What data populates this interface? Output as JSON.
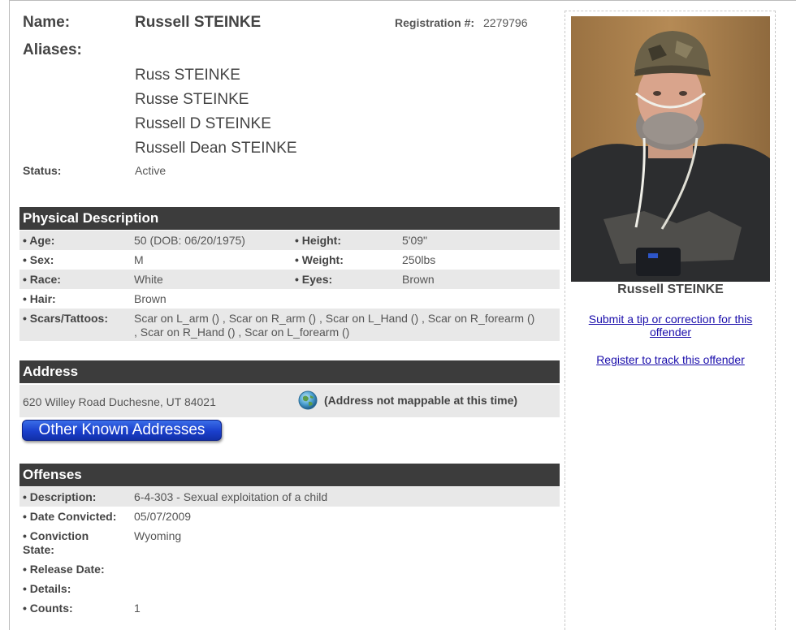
{
  "header": {
    "name_label": "Name:",
    "name_value": "Russell STEINKE",
    "registration_label": "Registration #:",
    "registration_value": "2279796",
    "aliases_label": "Aliases:",
    "aliases": [
      "Russ STEINKE",
      "Russe STEINKE",
      "Russell D STEINKE",
      "Russell Dean STEINKE"
    ],
    "status_label": "Status:",
    "status_value": "Active"
  },
  "physical": {
    "title": "Physical Description",
    "age_label": "• Age:",
    "age_value": "50  (DOB: 06/20/1975)",
    "height_label": "• Height:",
    "height_value": "5'09\"",
    "sex_label": "• Sex:",
    "sex_value": "M",
    "weight_label": "• Weight:",
    "weight_value": "250lbs",
    "race_label": "• Race:",
    "race_value": "White",
    "eyes_label": "• Eyes:",
    "eyes_value": "Brown",
    "hair_label": "• Hair:",
    "hair_value": "Brown",
    "scars_label": "• Scars/Tattoos:",
    "scars_line1": "Scar on L_arm () , Scar on R_arm () , Scar on L_Hand () , Scar on R_forearm ()",
    "scars_line2": ", Scar on R_Hand () , Scar on L_forearm ()"
  },
  "address": {
    "title": "Address",
    "value": "620 Willey Road Duchesne, UT 84021",
    "map_note": "(Address not mappable at this time)",
    "other_button": "Other Known Addresses"
  },
  "offenses": {
    "title": "Offenses",
    "description_label": "• Description:",
    "description_value": "6-4-303 - Sexual exploitation of a child",
    "date_label": "• Date Convicted:",
    "date_value": "05/07/2009",
    "state_label_1": "• Conviction",
    "state_label_2": "State:",
    "state_value": "Wyoming",
    "release_label": "• Release Date:",
    "details_label": "• Details:",
    "counts_label": "• Counts:",
    "counts_value": "1"
  },
  "sidebar": {
    "photo_caption": "Russell STEINKE",
    "tip_link_1": "Submit a tip or correction for this",
    "tip_link_2": "offender",
    "track_link": "Register to track this offender"
  },
  "icons": {
    "map": "globe-icon"
  },
  "colors": {
    "section_header": "#3c3c3c",
    "shade_row": "#e8e8e8",
    "link": "#1a0dab",
    "button": "#1a3fcc"
  }
}
